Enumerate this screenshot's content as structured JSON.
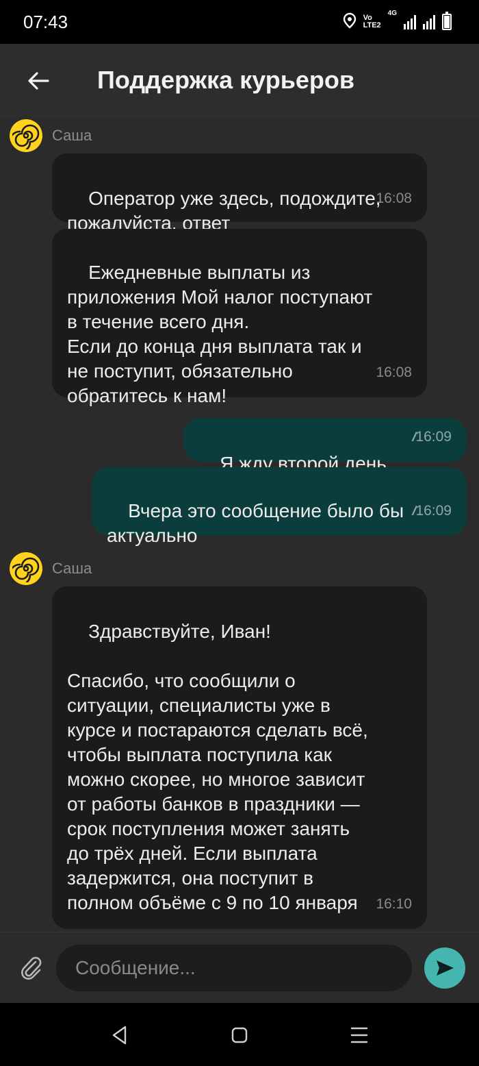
{
  "status_bar": {
    "time": "07:43",
    "network_top": "Vo",
    "network_bottom": "LTE2",
    "signal_label": "4G",
    "icons": [
      "location-icon",
      "volte-icon",
      "signal-icon",
      "battery-icon"
    ]
  },
  "header": {
    "title": "Поддержка курьеров",
    "back_icon": "arrow-left-icon"
  },
  "messages": [
    {
      "type": "sender",
      "name": "Саша",
      "avatar": "spiral-logo"
    },
    {
      "type": "incoming",
      "text": "Оператор уже здесь, подождите,\nпожалуйста, ответ",
      "time": "16:08"
    },
    {
      "type": "incoming",
      "text": "Ежедневные выплаты из\nприложения Мой налог поступают\nв течение всего дня.\nЕсли до конца дня выплата так и\nне поступит, обязательно\nобратитесь к нам!",
      "time": "16:08"
    },
    {
      "type": "outgoing",
      "text": "Я жду второй день",
      "time": "16:09",
      "status": "read"
    },
    {
      "type": "outgoing",
      "text": "Вчера это сообщение было бы\nактуально",
      "time": "16:09",
      "status": "read"
    },
    {
      "type": "sender",
      "name": "Саша",
      "avatar": "spiral-logo"
    },
    {
      "type": "incoming",
      "text": "Здравствуйте, Иван!\n\nСпасибо, что сообщили о\nситуации, специалисты уже в\nкурсе и постараются сделать всё,\nчтобы выплата поступила как\nможно скорее, но многое зависит\nот работы банков в праздники —\nсрок поступления может занять\nдо трёх дней. Если выплата\nзадержится, она поступит в\nполном объёме с 9 по 10 января",
      "time": "16:10"
    }
  ],
  "composer": {
    "placeholder": "Сообщение...",
    "value": "",
    "attach_icon": "paperclip-icon",
    "send_icon": "send-icon"
  },
  "nav_bar": {
    "buttons": [
      "back-triangle-icon",
      "home-square-icon",
      "recents-menu-icon"
    ]
  },
  "colors": {
    "background": "#2b2b2b",
    "incoming_bubble": "#1b1b1b",
    "outgoing_bubble": "#0a3d3b",
    "accent_send": "#45b5b0",
    "avatar_yellow": "#ffd21e"
  }
}
